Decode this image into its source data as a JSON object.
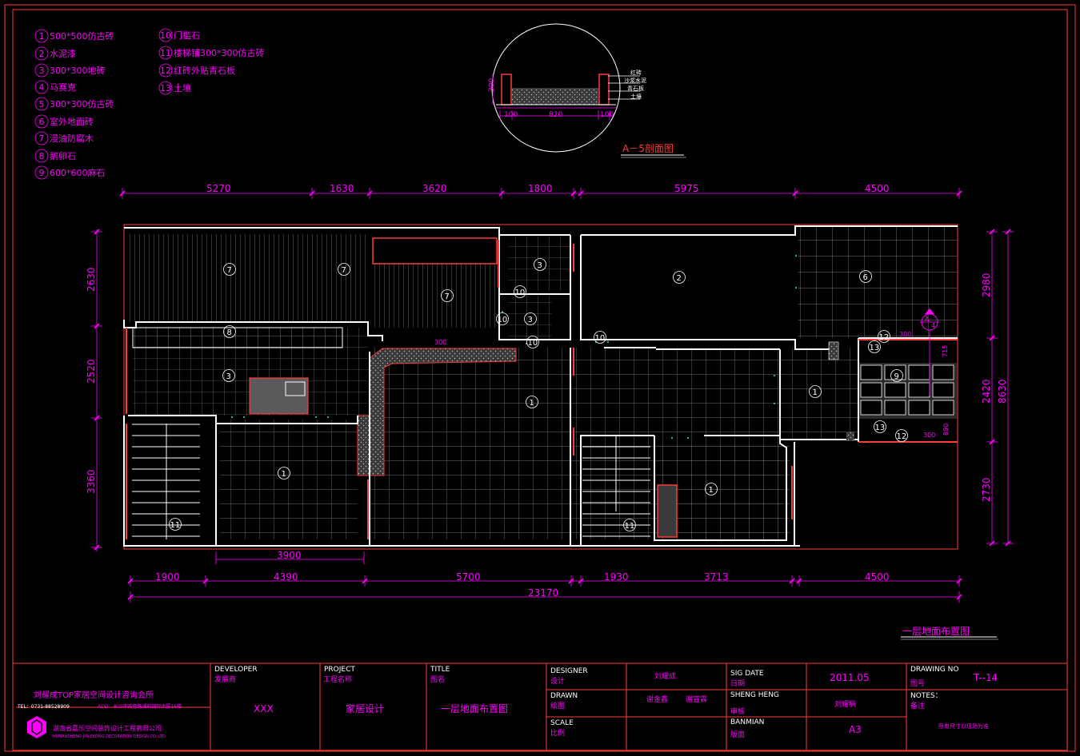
{
  "legend": [
    "500*500仿古砖",
    "水泥漆",
    "300*300地砖",
    "马赛克",
    "300*300仿古砖",
    "室外地面砖",
    "浸油防腐木",
    "鹅卵石",
    "600*600麻石",
    "门槛石",
    "楼梯铺300*300仿古砖",
    "红砖外贴青石板",
    "土壤"
  ],
  "legend_numbers": [
    "1",
    "2",
    "3",
    "4",
    "5",
    "6",
    "7",
    "8",
    "9",
    "10",
    "11",
    "12",
    "13"
  ],
  "section": {
    "title": "A－5剖面图",
    "labels": [
      "红砖",
      "沙浆水泥",
      "青石板",
      "土壤"
    ],
    "dims": [
      "100",
      "820",
      "100",
      "300"
    ]
  },
  "top_dims": [
    "5270",
    "1630",
    "3620",
    "1800",
    "5975",
    "4500"
  ],
  "bottom_dims": [
    "1900",
    "4390",
    "5700",
    "1930",
    "3713",
    "4500"
  ],
  "bottom_total": "23170",
  "inner_dim": "3900",
  "left_dims": [
    "2630",
    "2520",
    "3360"
  ],
  "right_dims": [
    "2980",
    "2420",
    "2730"
  ],
  "right_total": "8630",
  "room_labels": [
    "7",
    "7",
    "7",
    "3",
    "3",
    "2",
    "6",
    "8",
    "3",
    "1",
    "1",
    "1",
    "1",
    "11",
    "11",
    "10",
    "10",
    "10",
    "10",
    "12",
    "12",
    "13",
    "13",
    "9"
  ],
  "small_dims": [
    "300",
    "300",
    "300",
    "715",
    "890"
  ],
  "marker": {
    "label": "A",
    "number": "4"
  },
  "plan_title": "一层地面布置图",
  "titleblock": {
    "company": "刘耀成TOP家居空间设计咨询会所",
    "tel": "TEL：0731-88528909",
    "addr": "ADD：长沙市芙蓉路湘府国际大厦16楼",
    "logo_cn": "湖南省嘉乐空间装饰设计工程有限公司",
    "logo_en": "HUNANSHENG JIALEKONG DECORATION DESIGN CO.,LTD",
    "developer_h": "DEVELOPER",
    "developer_sub": "发展商",
    "developer_val": "XXX",
    "project_h": "PROJECT",
    "project_sub": "工程名称",
    "project_val": "家居设计",
    "title_h": "TITLE",
    "title_sub": "图名",
    "title_val": "一层地面布置图",
    "designer_h": "DESIGNER",
    "designer_sub": "设计",
    "designer_val": "刘耀成",
    "drawn_h": "DRAWN",
    "drawn_sub": "绘图",
    "drawn_val1": "谢金鑫",
    "drawn_val2": "谢宣霖",
    "scale_h": "SCALE",
    "scale_sub": "比例",
    "sigdate_h": "SIG DATE",
    "sigdate_sub": "日期",
    "sigdate_val": "2011.05",
    "shenheng_h": "SHENG HENG",
    "shenheng_sub": "审核",
    "shenheng_val": "刘耀枫",
    "banmian_h": "BANMIAN",
    "banmian_sub": "版面",
    "banmian_val": "A3",
    "drawingno_h": "DRAWING NO",
    "drawingno_sub": "图号",
    "drawingno_val": "T--14",
    "notes_h": "NOTES：",
    "notes_sub": "备注",
    "notes_val": "所有尺寸以现场为准"
  }
}
